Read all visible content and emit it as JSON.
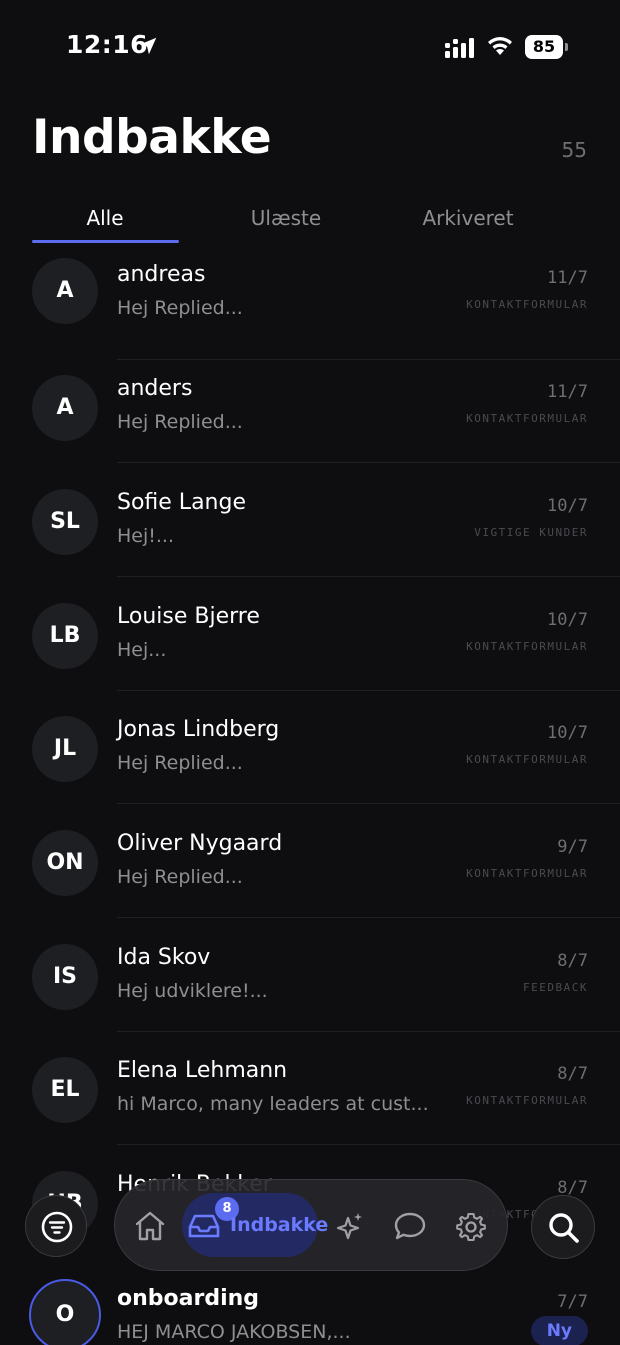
{
  "status": {
    "time": "12:16",
    "battery": "85"
  },
  "header": {
    "title": "Indbakke",
    "count": "55"
  },
  "tabs": [
    {
      "label": "Alle",
      "active": true
    },
    {
      "label": "Ulæste",
      "active": false
    },
    {
      "label": "Arkiveret",
      "active": false
    }
  ],
  "conversations": [
    {
      "initials": "A",
      "name": "andreas",
      "preview": "Hej Replied...",
      "date": "11/7",
      "tag": "KONTAKTFORMULAR"
    },
    {
      "initials": "A",
      "name": "anders",
      "preview": "Hej Replied...",
      "date": "11/7",
      "tag": "KONTAKTFORMULAR"
    },
    {
      "initials": "SL",
      "name": "Sofie Lange",
      "preview": "Hej!...",
      "date": "10/7",
      "tag": "VIGTIGE KUNDER"
    },
    {
      "initials": "LB",
      "name": "Louise Bjerre",
      "preview": "Hej...",
      "date": "10/7",
      "tag": "KONTAKTFORMULAR"
    },
    {
      "initials": "JL",
      "name": "Jonas Lindberg",
      "preview": "Hej Replied...",
      "date": "10/7",
      "tag": "KONTAKTFORMULAR"
    },
    {
      "initials": "ON",
      "name": "Oliver Nygaard",
      "preview": "Hej Replied...",
      "date": "9/7",
      "tag": "KONTAKTFORMULAR"
    },
    {
      "initials": "IS",
      "name": "Ida Skov",
      "preview": "Hej udviklere!...",
      "date": "8/7",
      "tag": "FEEDBACK"
    },
    {
      "initials": "EL",
      "name": "Elena Lehmann",
      "preview": "hi Marco, many leaders at cust...",
      "date": "8/7",
      "tag": "KONTAKTFORMULAR"
    },
    {
      "initials": "HB",
      "name": "Henrik Bekker",
      "preview": "",
      "date": "8/7",
      "tag": "KONTAKTFORMULAR"
    },
    {
      "initials": "O",
      "name": "onboarding",
      "preview": "HEJ MARCO JAKOBSEN,...",
      "date": "7/7",
      "badge": "Ny"
    }
  ],
  "nav": {
    "active_label": "Indbakke",
    "unread_count": "8",
    "items": [
      "home-icon",
      "inbox-icon",
      "sparkles-icon",
      "chat-icon",
      "settings-icon"
    ]
  },
  "colors": {
    "accent": "#5b6cf0",
    "background": "#0e0e10",
    "avatar": "#1e1f23"
  }
}
